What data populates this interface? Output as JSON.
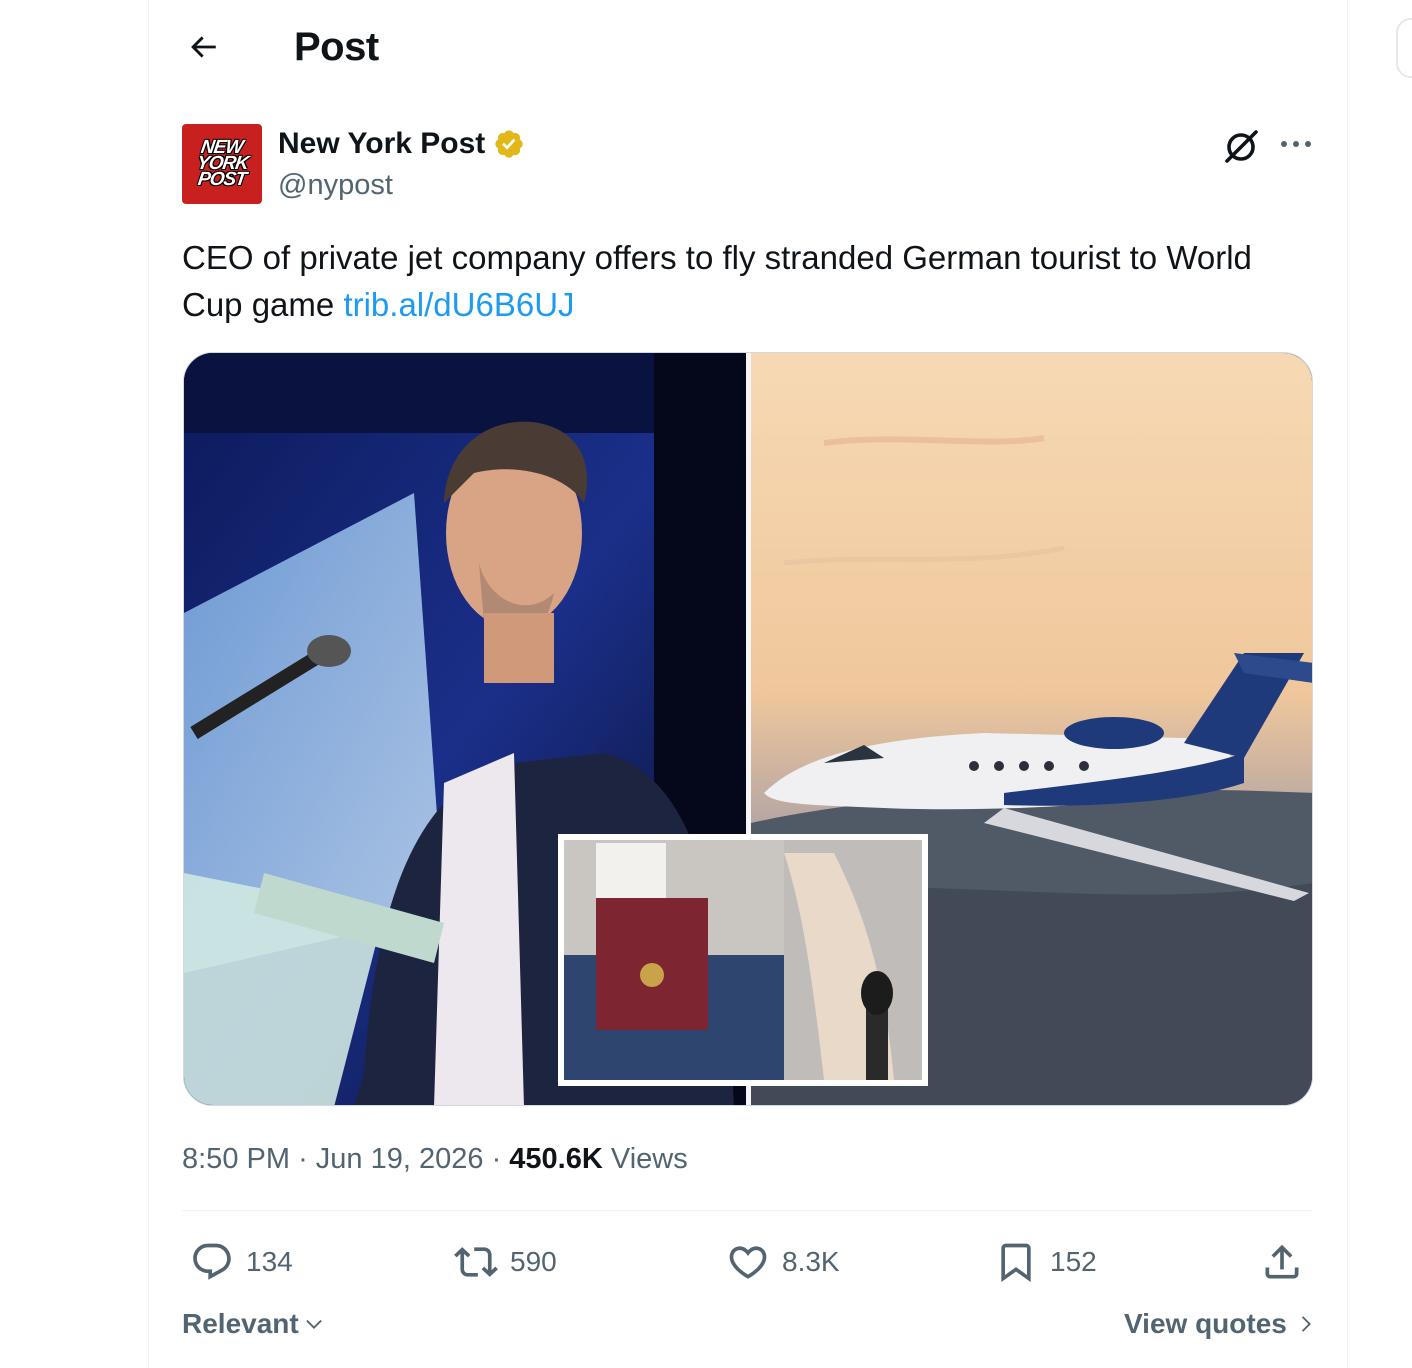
{
  "header": {
    "title": "Post"
  },
  "author": {
    "logo_lines": [
      "NEW",
      "YORK",
      "POST"
    ],
    "name": "New York Post",
    "handle": "@nypost",
    "verified_color": "#e2b719"
  },
  "tweet": {
    "text": "CEO of private jet company offers to fly stranded German tourist to World Cup game ",
    "link": "trib.al/dU6B6UJ",
    "link_color": "#1d9bf0"
  },
  "media": {
    "panels": [
      "speaker-at-podium-photo",
      "private-jet-in-flight-photo",
      "passport-in-pocket-inset-photo"
    ]
  },
  "meta": {
    "time": "8:50 PM",
    "separator": "·",
    "date": "Jun 19, 2026",
    "views_count": "450.6K",
    "views_label": "Views"
  },
  "actions": {
    "replies": "134",
    "reposts": "590",
    "likes": "8.3K",
    "bookmarks": "152"
  },
  "footer": {
    "sort_label": "Relevant",
    "view_quotes": "View quotes"
  },
  "colors": {
    "text": "#0f1419",
    "secondary": "#536471",
    "border": "#eff3f4",
    "brand_red": "#c8201e"
  }
}
